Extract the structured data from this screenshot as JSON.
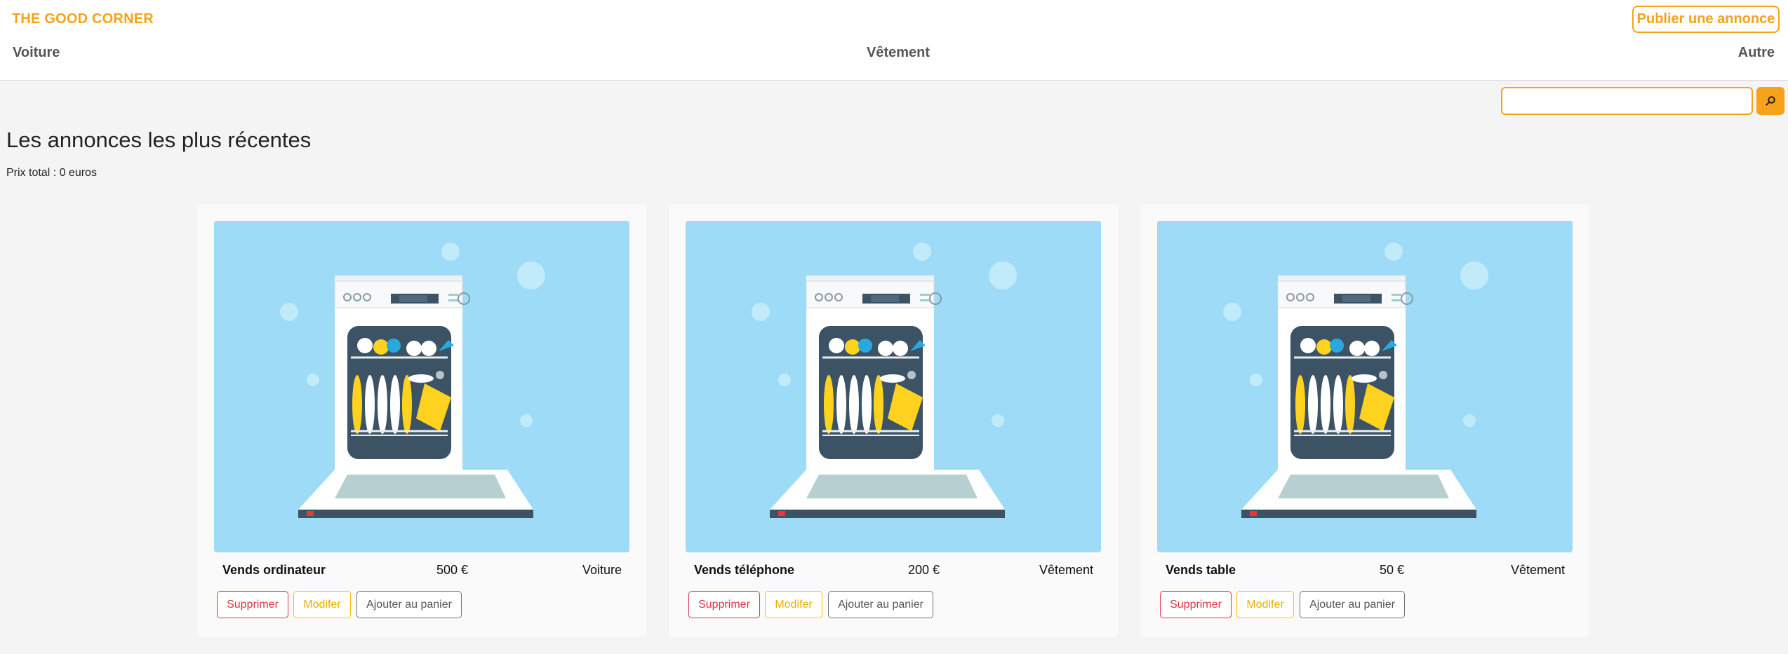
{
  "header": {
    "logo": "THE GOOD CORNER",
    "publish_label": "Publier une annonce",
    "categories": [
      "Voiture",
      "Vêtement",
      "Autre"
    ]
  },
  "search": {
    "placeholder": "",
    "value": "",
    "icon": "search-icon"
  },
  "main": {
    "title": "Les annonces les plus récentes",
    "total": "Prix total : 0 euros"
  },
  "cards": [
    {
      "title": "Vends ordinateur",
      "price": "500 €",
      "category": "Voiture",
      "image": "dishwasher-illustration"
    },
    {
      "title": "Vends téléphone",
      "price": "200 €",
      "category": "Vêtement",
      "image": "dishwasher-illustration"
    },
    {
      "title": "Vends table",
      "price": "50 €",
      "category": "Vêtement",
      "image": "dishwasher-illustration"
    }
  ],
  "card_actions": {
    "delete": "Supprimer",
    "edit": "Modifer",
    "cart": "Ajouter au panier"
  },
  "colors": {
    "brand": "#f7a21b",
    "danger": "#dc3545",
    "warning": "#ffc107",
    "secondary": "#6c757d",
    "image_bg": "#9ddbf6"
  }
}
